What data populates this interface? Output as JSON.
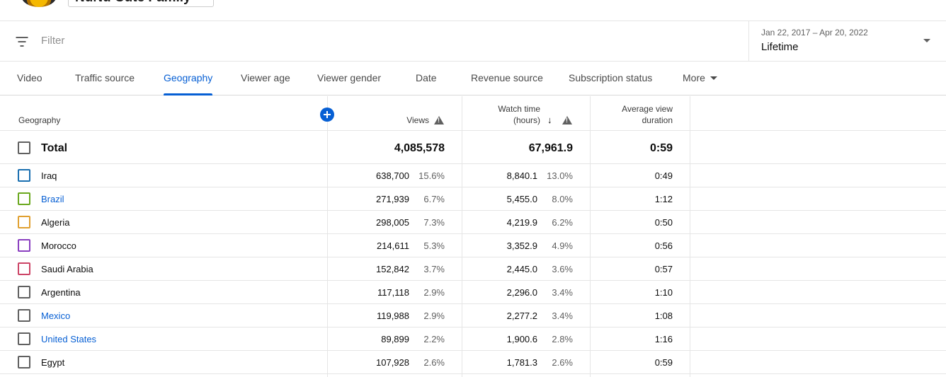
{
  "channel": {
    "name": "NuNu Cute Family"
  },
  "filter": {
    "placeholder": "Filter"
  },
  "date_picker": {
    "range": "Jan 22, 2017 – Apr 20, 2022",
    "period": "Lifetime"
  },
  "tabs": [
    {
      "label": "Video",
      "active": false
    },
    {
      "label": "Traffic source",
      "active": false
    },
    {
      "label": "Geography",
      "active": true
    },
    {
      "label": "Viewer age",
      "active": false
    },
    {
      "label": "Viewer gender",
      "active": false
    },
    {
      "label": "Date",
      "active": false
    },
    {
      "label": "Revenue source",
      "active": false
    },
    {
      "label": "Subscription status",
      "active": false
    },
    {
      "label": "More",
      "active": false
    }
  ],
  "table": {
    "headers": {
      "dimension": "Geography",
      "views": "Views",
      "watch_time_line1": "Watch time",
      "watch_time_line2": "(hours)",
      "avg_line1": "Average view",
      "avg_line2": "duration"
    },
    "total": {
      "label": "Total",
      "views": "4,085,578",
      "watch_time": "67,961.9",
      "avg_duration": "0:59"
    },
    "rows": [
      {
        "name": "Iraq",
        "link": false,
        "color": "#1a6fb0",
        "views": "638,700",
        "views_pct": "15.6%",
        "watch_time": "8,840.1",
        "watch_pct": "13.0%",
        "avg_duration": "0:49"
      },
      {
        "name": "Brazil",
        "link": true,
        "color": "#6aa81e",
        "views": "271,939",
        "views_pct": "6.7%",
        "watch_time": "5,455.0",
        "watch_pct": "8.0%",
        "avg_duration": "1:12"
      },
      {
        "name": "Algeria",
        "link": false,
        "color": "#e0a030",
        "views": "298,005",
        "views_pct": "7.3%",
        "watch_time": "4,219.9",
        "watch_pct": "6.2%",
        "avg_duration": "0:50"
      },
      {
        "name": "Morocco",
        "link": false,
        "color": "#8a3fc0",
        "views": "214,611",
        "views_pct": "5.3%",
        "watch_time": "3,352.9",
        "watch_pct": "4.9%",
        "avg_duration": "0:56"
      },
      {
        "name": "Saudi Arabia",
        "link": false,
        "color": "#cc4466",
        "views": "152,842",
        "views_pct": "3.7%",
        "watch_time": "2,445.0",
        "watch_pct": "3.6%",
        "avg_duration": "0:57"
      },
      {
        "name": "Argentina",
        "link": false,
        "color": "#606060",
        "views": "117,118",
        "views_pct": "2.9%",
        "watch_time": "2,296.0",
        "watch_pct": "3.4%",
        "avg_duration": "1:10"
      },
      {
        "name": "Mexico",
        "link": true,
        "color": "#606060",
        "views": "119,988",
        "views_pct": "2.9%",
        "watch_time": "2,277.2",
        "watch_pct": "3.4%",
        "avg_duration": "1:08"
      },
      {
        "name": "United States",
        "link": true,
        "color": "#606060",
        "views": "89,899",
        "views_pct": "2.2%",
        "watch_time": "1,900.6",
        "watch_pct": "2.8%",
        "avg_duration": "1:16"
      },
      {
        "name": "Egypt",
        "link": false,
        "color": "#606060",
        "views": "107,928",
        "views_pct": "2.6%",
        "watch_time": "1,781.3",
        "watch_pct": "2.6%",
        "avg_duration": "0:59"
      }
    ]
  }
}
